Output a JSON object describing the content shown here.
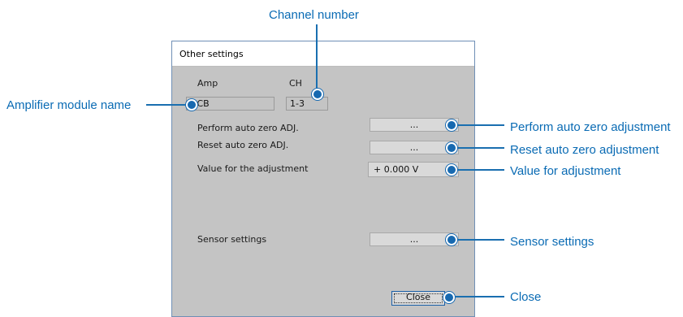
{
  "callouts": {
    "channel_number": "Channel number",
    "amplifier_module_name": "Amplifier module name",
    "perform_auto_zero": "Perform auto zero adjustment",
    "reset_auto_zero": "Reset auto zero adjustment",
    "value_for_adjustment": "Value for adjustment",
    "sensor_settings": "Sensor settings",
    "close": "Close"
  },
  "dialog": {
    "title": "Other settings",
    "amp_label": "Amp",
    "ch_label": "CH",
    "amp_value": "DCB",
    "ch_value": "1-3",
    "perform_label": "Perform auto zero ADJ.",
    "perform_button": "...",
    "reset_label": "Reset auto zero ADJ.",
    "reset_button": "...",
    "value_label": "Value for the adjustment",
    "value_field": "+ 0.000 V",
    "sensor_label": "Sensor settings",
    "sensor_button": "...",
    "close_button": "Close"
  },
  "colors": {
    "callout_text": "#0a6bb4",
    "leader_line": "#1a6fb0",
    "dialog_body": "#c4c4c4",
    "dialog_border": "#6f8fb6"
  }
}
